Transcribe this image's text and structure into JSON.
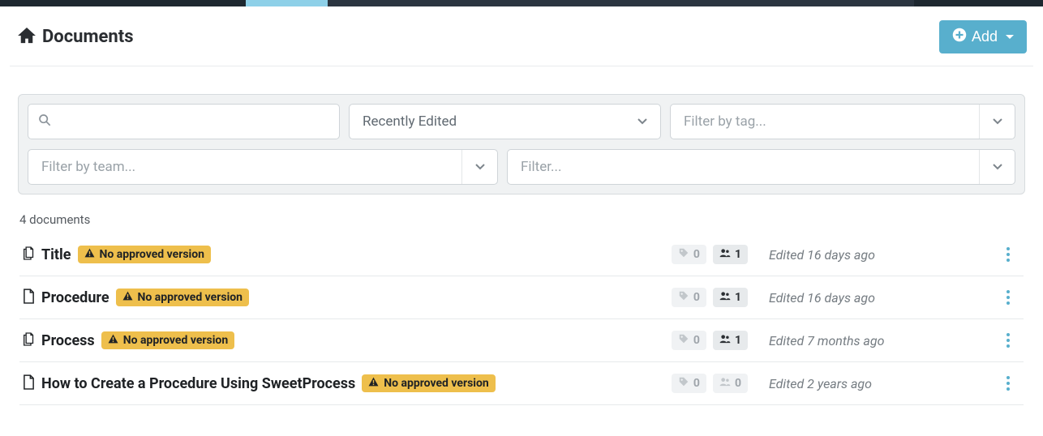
{
  "header": {
    "title": "Documents",
    "add_button": "Add"
  },
  "filters": {
    "search_placeholder": "",
    "sort_value": "Recently Edited",
    "tag_placeholder": "Filter by tag...",
    "team_placeholder": "Filter by team...",
    "generic_placeholder": "Filter..."
  },
  "documents": {
    "count_text": "4 documents",
    "warning_label": "No approved version",
    "items": [
      {
        "title": "Title",
        "type_icon": "stack",
        "tag_count": "0",
        "team_count": "1",
        "team_muted": false,
        "edited": "Edited 16 days ago"
      },
      {
        "title": "Procedure",
        "type_icon": "file",
        "tag_count": "0",
        "team_count": "1",
        "team_muted": false,
        "edited": "Edited 16 days ago"
      },
      {
        "title": "Process",
        "type_icon": "stack",
        "tag_count": "0",
        "team_count": "1",
        "team_muted": false,
        "edited": "Edited 7 months ago"
      },
      {
        "title": "How to Create a Procedure Using SweetProcess",
        "type_icon": "file",
        "tag_count": "0",
        "team_count": "0",
        "team_muted": true,
        "edited": "Edited 2 years ago"
      }
    ]
  }
}
